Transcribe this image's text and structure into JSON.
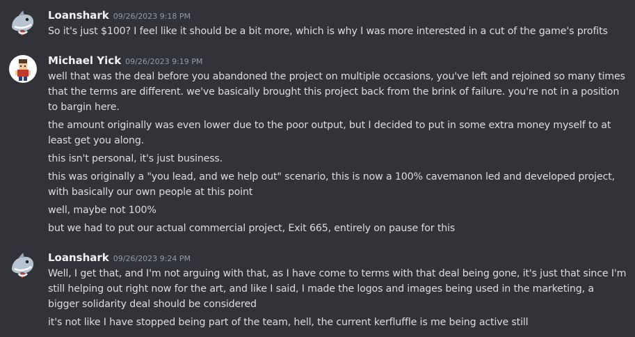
{
  "messages": [
    {
      "author": "Loanshark",
      "timestamp": "09/26/2023 9:18 PM",
      "lines": [
        "So it's just $100? I feel like it should be a bit more, which is why I was more interested in a cut of the game's profits"
      ]
    },
    {
      "author": "Michael Yick",
      "timestamp": "09/26/2023 9:19 PM",
      "lines": [
        "well that was the deal before you abandoned the project on multiple occasions, you've left and rejoined so many times that the terms are different. we've basically brought this project back from the brink of failure. you're not in a position to bargin here.",
        "the amount originally was even lower due to the poor output, but I decided to put in some extra money myself to at least get you along.",
        "this isn't personal, it's just business.",
        "this was originally a \"you lead, and we help out\" scenario, this is now a 100% cavemanon led and developed project, with basically our own people at this point",
        "well, maybe not 100%",
        "but we had to put our actual commercial project, Exit 665, entirely on pause for this"
      ]
    },
    {
      "author": "Loanshark",
      "timestamp": "09/26/2023 9:24 PM",
      "lines": [
        "Well, I get that, and I'm not arguing with that, as I have come to terms with that deal being gone, it's just that since I'm still helping out right now for the art, and like I said, I made the logos and images being used in the marketing, a bigger solidarity deal should be considered",
        "it's not like I have stopped being part of the team, hell, the current kerfluffle is me being active still"
      ]
    }
  ]
}
